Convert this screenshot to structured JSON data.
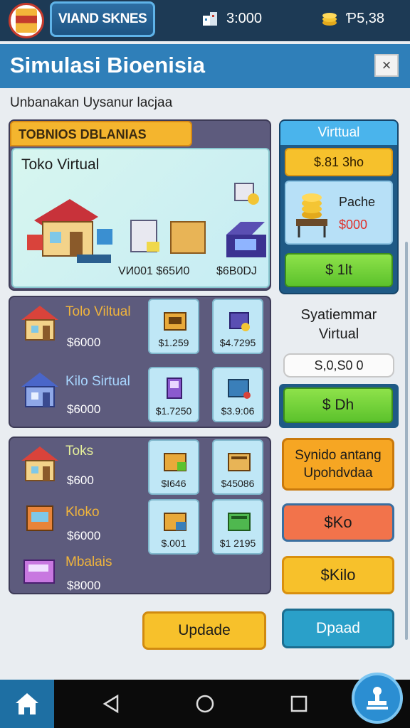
{
  "header": {
    "brand_label": "VIAND SKNES",
    "building_value": "3:000",
    "coins_value": "Ƥ5,38"
  },
  "titlebar": {
    "title": "Simulasi Bioenisia",
    "close_label": "×"
  },
  "subtitle": "Unbanakan Uysanur lacjaa",
  "featured": {
    "section_title": "TOBNIOS DBLANIAS",
    "name": "Toko Virtual",
    "price_1": "VИ001 $65И0",
    "price_2": "$6B0DJ"
  },
  "shops": [
    {
      "name": "Tolo Viltual",
      "price": "$6000",
      "tiles": [
        "$1.259",
        "$4.7295"
      ]
    },
    {
      "name": "Kilo Sirtual",
      "price": "$6000",
      "tiles": [
        "$1.7250",
        "$3.9:06"
      ]
    },
    {
      "name": "Toks",
      "price": "$600",
      "tiles": [
        "$I646",
        "$45086"
      ]
    },
    {
      "name": "Kloko",
      "price": "$6000",
      "tiles": [
        "$.001",
        "$1 2195"
      ]
    },
    {
      "name": "Mbalais",
      "price": "$8000"
    }
  ],
  "virtual_panel": {
    "header": "Virttual",
    "price": "$.81 3ho",
    "pack_name": "Pache",
    "pack_price": "$000",
    "buy_label": "$ 1lt"
  },
  "sys": {
    "label_line1": "Syatiemmar",
    "label_line2": "Virtual",
    "input_value": "S,0,S0 0",
    "buy_label": "$ Dh"
  },
  "buttons": {
    "sync_line1": "Synido antang",
    "sync_line2": "Upohdvdaa",
    "ko": "$Ko",
    "kilo": "$Kilo",
    "update": "Updade",
    "dpaad": "Dpaad"
  },
  "colors": {
    "topbar": "#1d3a55",
    "titlebar": "#2f7fb9",
    "panel": "#5d5b7d",
    "accent_yellow": "#f7c12b",
    "accent_green": "#5cc22c"
  }
}
